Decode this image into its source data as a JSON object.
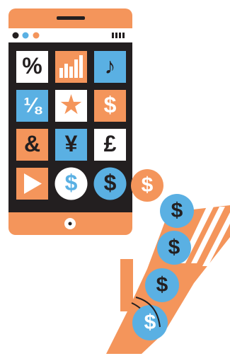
{
  "colors": {
    "orange": "#f4955b",
    "blue": "#5ab0e3",
    "dark": "#231f20",
    "white": "#ffffff",
    "red_dot": "#e4573d"
  },
  "phone": {
    "status_dots": [
      "dark",
      "blue",
      "orange"
    ],
    "signal_icon": "signal-bars-icon",
    "home_icon": "home-button-icon"
  },
  "apps": [
    {
      "name": "percent-app",
      "symbol": "%",
      "bg": "white",
      "fg": "dark",
      "icon": "percent-icon"
    },
    {
      "name": "chart-app",
      "symbol": "",
      "bg": "orange",
      "fg": "white",
      "icon": "bar-chart-icon"
    },
    {
      "name": "music-app",
      "symbol": "♪",
      "bg": "blue",
      "fg": "dark",
      "icon": "music-note-icon"
    },
    {
      "name": "fraction-app",
      "symbol": "⅛",
      "bg": "blue",
      "fg": "white",
      "icon": "fraction-icon"
    },
    {
      "name": "favorites-app",
      "symbol": "★",
      "bg": "white",
      "fg": "orange",
      "icon": "star-icon"
    },
    {
      "name": "dollar-app",
      "symbol": "$",
      "bg": "orange",
      "fg": "white",
      "icon": "dollar-icon"
    },
    {
      "name": "ampersand-app",
      "symbol": "&",
      "bg": "orange",
      "fg": "dark",
      "icon": "ampersand-icon"
    },
    {
      "name": "yen-app",
      "symbol": "¥",
      "bg": "blue",
      "fg": "dark",
      "icon": "yen-icon"
    },
    {
      "name": "pound-app",
      "symbol": "£",
      "bg": "white",
      "fg": "dark",
      "icon": "pound-icon"
    },
    {
      "name": "play-app",
      "symbol": "",
      "bg": "orange",
      "fg": "white",
      "icon": "play-icon"
    },
    {
      "name": "coin-app-white",
      "symbol": "$",
      "bg": "white",
      "fg": "blue",
      "icon": "dollar-coin-icon"
    },
    {
      "name": "coin-app-blue",
      "symbol": "$",
      "bg": "blue",
      "fg": "dark",
      "icon": "dollar-coin-icon"
    }
  ],
  "coins": [
    {
      "symbol": "$",
      "bg": "orange",
      "fg": "white"
    },
    {
      "symbol": "$",
      "bg": "blue",
      "fg": "dark"
    },
    {
      "symbol": "$",
      "bg": "blue",
      "fg": "dark"
    },
    {
      "symbol": "$",
      "bg": "blue",
      "fg": "dark"
    },
    {
      "symbol": "$",
      "bg": "blue",
      "fg": "white"
    }
  ]
}
